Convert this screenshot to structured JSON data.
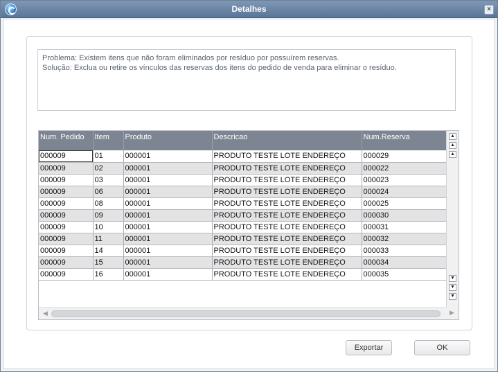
{
  "window": {
    "title": "Detalhes",
    "close_glyph": "×"
  },
  "message": {
    "line1": "Problema: Existem itens que não foram eliminados por resíduo por possuírem reservas.",
    "line2": "Solução: Exclua ou retire os vínculos das reservas dos itens do pedido de venda para eliminar o resíduo."
  },
  "table": {
    "columns": [
      "Num. Pedido",
      "Item",
      "Produto",
      "Descricao",
      "Num.Reserva"
    ],
    "rows": [
      [
        "000009",
        "01",
        "000001",
        "PRODUTO TESTE LOTE ENDEREÇO",
        "000029"
      ],
      [
        "000009",
        "02",
        "000001",
        "PRODUTO TESTE LOTE ENDEREÇO",
        "000022"
      ],
      [
        "000009",
        "03",
        "000001",
        "PRODUTO TESTE LOTE ENDEREÇO",
        "000023"
      ],
      [
        "000009",
        "06",
        "000001",
        "PRODUTO TESTE LOTE ENDEREÇO",
        "000024"
      ],
      [
        "000009",
        "08",
        "000001",
        "PRODUTO TESTE LOTE ENDEREÇO",
        "000025"
      ],
      [
        "000009",
        "09",
        "000001",
        "PRODUTO TESTE LOTE ENDEREÇO",
        "000030"
      ],
      [
        "000009",
        "10",
        "000001",
        "PRODUTO TESTE LOTE ENDEREÇO",
        "000031"
      ],
      [
        "000009",
        "11",
        "000001",
        "PRODUTO TESTE LOTE ENDEREÇO",
        "000032"
      ],
      [
        "000009",
        "14",
        "000001",
        "PRODUTO TESTE LOTE ENDEREÇO",
        "000033"
      ],
      [
        "000009",
        "15",
        "000001",
        "PRODUTO TESTE LOTE ENDEREÇO",
        "000034"
      ],
      [
        "000009",
        "16",
        "000001",
        "PRODUTO TESTE LOTE ENDEREÇO",
        "000035"
      ]
    ]
  },
  "buttons": {
    "export_label": "Exportar",
    "ok_label": "OK"
  },
  "icons": {
    "app": "app-logo-icon",
    "close": "close-icon",
    "scroll_top": "scroll-top-icon",
    "scroll_page_up": "scroll-page-up-icon",
    "scroll_up": "scroll-up-icon",
    "scroll_down": "scroll-down-icon",
    "scroll_page_down": "scroll-page-down-icon",
    "scroll_bottom": "scroll-bottom-icon"
  },
  "colors": {
    "titlebar": "#6b85a8",
    "header": "#7c8591",
    "row_alt": "#e3e3e3"
  }
}
